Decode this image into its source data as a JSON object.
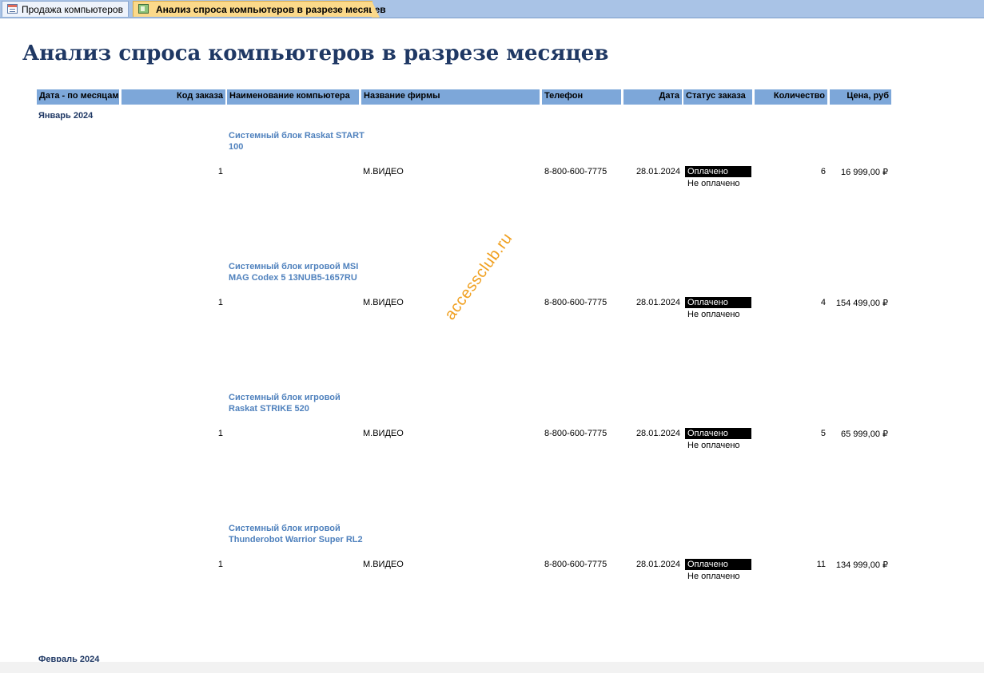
{
  "tabs": [
    {
      "label": "Продажа компьютеров",
      "icon": "form-icon"
    },
    {
      "label": "Анализ спроса компьютеров в разрезе месяцев",
      "icon": "report-icon"
    }
  ],
  "report": {
    "title": "Анализ спроса компьютеров в разрезе месяцев",
    "columns": {
      "month": "Дата - по месяцам",
      "order_id": "Код заказа",
      "computer": "Наименование компьютера",
      "company": "Название фирмы",
      "phone": "Телефон",
      "date": "Дата",
      "status": "Статус заказа",
      "qty": "Количество",
      "price": "Цена, руб"
    },
    "groups": [
      {
        "month": "Январь 2024",
        "rows": [
          {
            "computer": "Системный блок Raskat START 100",
            "order_id": "1",
            "company": "М.ВИДЕО",
            "phone": "8-800-600-7775",
            "date": "28.01.2024",
            "status_selected": "Оплачено",
            "status_other": "Не оплачено",
            "qty": "6",
            "price": "16 999,00 ₽"
          },
          {
            "computer": "Системный блок игровой MSI MAG Codex 5 13NUB5-1657RU",
            "order_id": "1",
            "company": "М.ВИДЕО",
            "phone": "8-800-600-7775",
            "date": "28.01.2024",
            "status_selected": "Оплачено",
            "status_other": "Не оплачено",
            "qty": "4",
            "price": "154 499,00 ₽"
          },
          {
            "computer": "Системный блок игровой Raskat STRIKE 520",
            "order_id": "1",
            "company": "М.ВИДЕО",
            "phone": "8-800-600-7775",
            "date": "28.01.2024",
            "status_selected": "Оплачено",
            "status_other": "Не оплачено",
            "qty": "5",
            "price": "65 999,00 ₽"
          },
          {
            "computer": "Системный блок игровой Thunderobot Warrior Super RL2",
            "order_id": "1",
            "company": "М.ВИДЕО",
            "phone": "8-800-600-7775",
            "date": "28.01.2024",
            "status_selected": "Оплачено",
            "status_other": "Не оплачено",
            "qty": "11",
            "price": "134 999,00 ₽"
          }
        ]
      },
      {
        "month": "Февраль 2024",
        "rows": []
      }
    ],
    "watermark": "accessclub.ru"
  }
}
